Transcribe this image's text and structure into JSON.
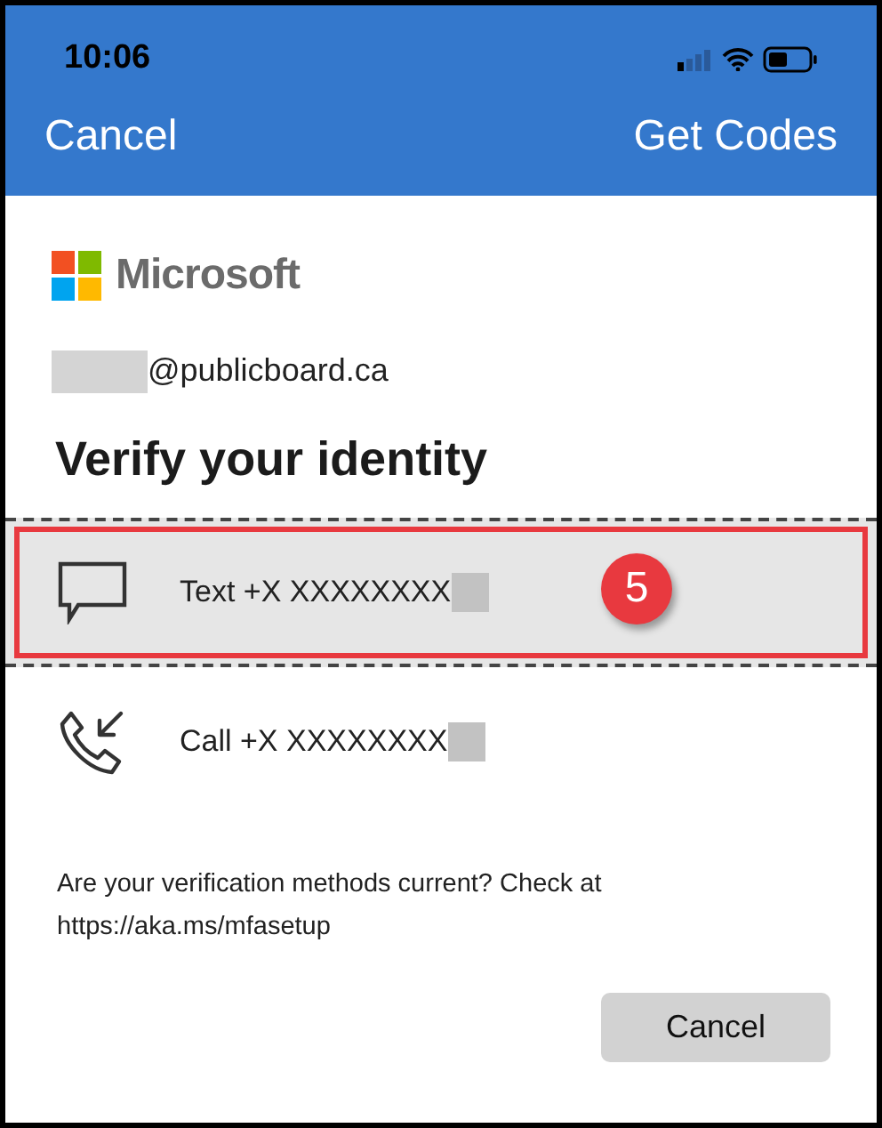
{
  "status_bar": {
    "time": "10:06"
  },
  "nav": {
    "left": "Cancel",
    "right": "Get Codes"
  },
  "brand": {
    "name": "Microsoft"
  },
  "account": {
    "email": "@publicboard.ca"
  },
  "heading": "Verify your identity",
  "methods": [
    {
      "kind": "text",
      "label": "Text +X XXXXXXXX",
      "selected": true
    },
    {
      "kind": "call",
      "label": "Call +X XXXXXXXX",
      "selected": false
    }
  ],
  "annotation": {
    "label": "5"
  },
  "footer": {
    "note": "Are your verification methods current? Check at https://aka.ms/mfasetup"
  },
  "buttons": [
    {
      "label": "Cancel"
    }
  ]
}
